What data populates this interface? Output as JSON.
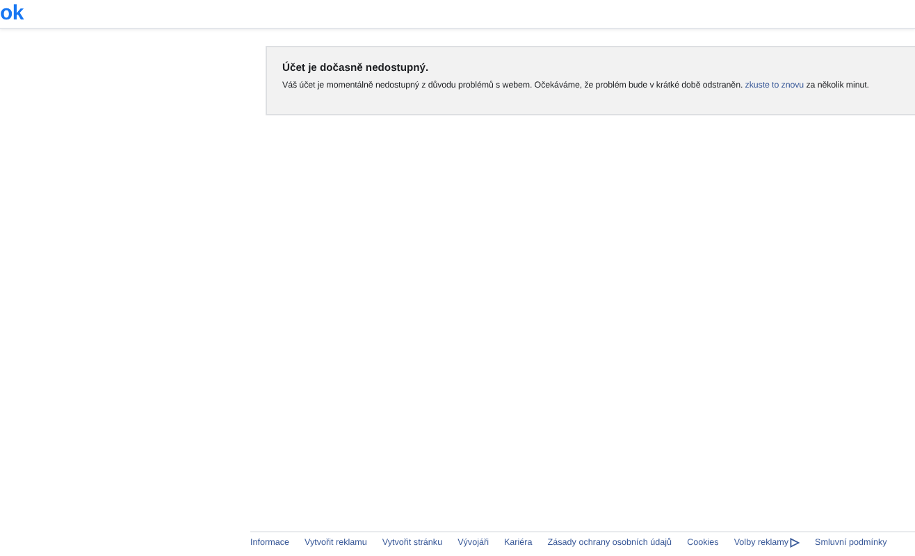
{
  "header": {
    "logo": "ok"
  },
  "notice": {
    "title": "Účet je dočasně nedostupný.",
    "text_before": "Váš účet je momentálně nedostupný z důvodu problémů s webem. Očekáváme, že problém bude v krátké době odstraněn.",
    "link": "zkuste to znovu",
    "text_after": "za několik minut."
  },
  "footer_links": [
    {
      "label": "Informace",
      "kind": "plain"
    },
    {
      "label": "Vytvořit reklamu",
      "kind": "plain"
    },
    {
      "label": "Vytvořit stránku",
      "kind": "plain"
    },
    {
      "label": "Vývojáři",
      "kind": "plain"
    },
    {
      "label": "Kariéra",
      "kind": "plain"
    },
    {
      "label": "Zásady ochrany osobních údajů",
      "kind": "plain"
    },
    {
      "label": "Cookies",
      "kind": "plain"
    },
    {
      "label": "Volby reklamy",
      "kind": "adchoices"
    },
    {
      "label": "Smluvní podmínky",
      "kind": "plain"
    }
  ]
}
